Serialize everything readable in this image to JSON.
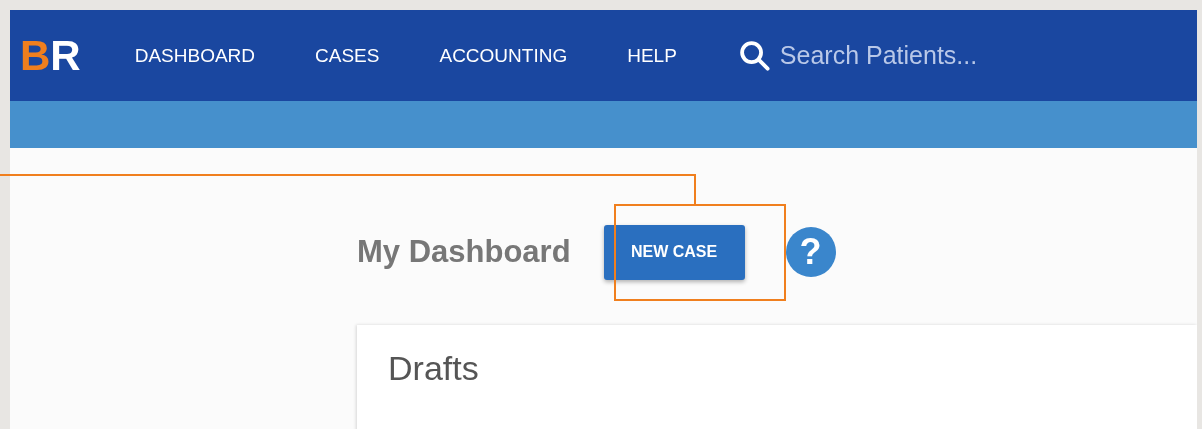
{
  "logo": {
    "parts": [
      {
        "text": "B",
        "color": "#f07f1e"
      },
      {
        "text": "R",
        "color": "#ffffff"
      }
    ]
  },
  "nav": {
    "items": [
      {
        "label": "DASHBOARD"
      },
      {
        "label": "CASES"
      },
      {
        "label": "ACCOUNTING"
      },
      {
        "label": "HELP"
      }
    ],
    "search": {
      "placeholder": "Search Patients..."
    }
  },
  "page": {
    "title": "My Dashboard",
    "new_case_button": "NEW CASE",
    "help": "?"
  },
  "drafts_card": {
    "title": "Drafts"
  }
}
